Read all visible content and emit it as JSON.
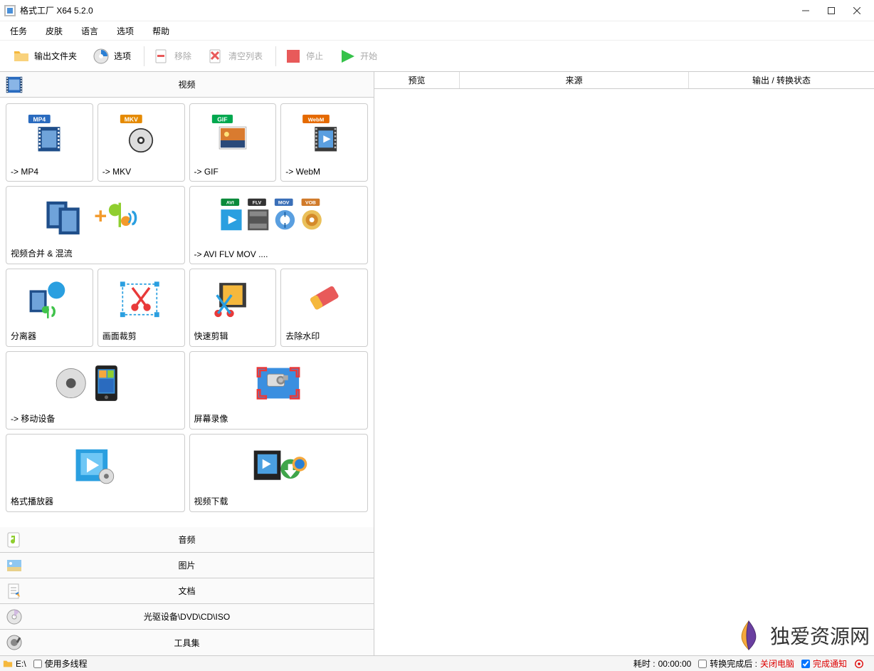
{
  "window": {
    "title": "格式工厂 X64 5.2.0"
  },
  "menus": {
    "task": "任务",
    "skin": "皮肤",
    "language": "语言",
    "options": "选项",
    "help": "帮助"
  },
  "toolbar": {
    "output_folder": "输出文件夹",
    "options": "选项",
    "remove": "移除",
    "clear_list": "清空列表",
    "stop": "停止",
    "start": "开始"
  },
  "categories": {
    "video": "视频",
    "audio": "音频",
    "picture": "图片",
    "document": "文档",
    "disc": "光驱设备\\DVD\\CD\\ISO",
    "tools": "工具集"
  },
  "tiles": {
    "mp4": "-> MP4",
    "mkv": "-> MKV",
    "gif": "-> GIF",
    "webm": "-> WebM",
    "merge_mux": "视频合并 & 混流",
    "more_formats": "-> AVI FLV MOV ....",
    "splitter": "分离器",
    "crop": "画面裁剪",
    "quick_trim": "快速剪辑",
    "remove_wm": "去除水印",
    "mobile": "-> 移动设备",
    "screen_rec": "屏幕录像",
    "player": "格式播放器",
    "download": "视频下载"
  },
  "list_headers": {
    "preview": "预览",
    "source": "来源",
    "output_status": "输出 / 转换状态"
  },
  "statusbar": {
    "drive": "E:\\",
    "multithread": "使用多线程",
    "elapsed_label": "耗时 :",
    "elapsed_value": "00:00:00",
    "after_convert": "转换完成后 :",
    "shutdown": "关闭电脑",
    "notify": "完成通知"
  },
  "watermark": "独爱资源网",
  "badges": {
    "mp4": "MP4",
    "mkv": "MKV",
    "gif": "GIF",
    "webm": "WebM",
    "avi": "AVI",
    "flv": "FLV",
    "mov": "MOV",
    "vob": "VOB"
  },
  "colors": {
    "mp4": "#2a6bbf",
    "mkv": "#e58a00",
    "gif": "#00a84f",
    "webm": "#e56a00",
    "avi": "#0a8a3a",
    "flv": "#333",
    "mov": "#3a6fb8",
    "vob": "#d07a2a",
    "play": "#36c24a",
    "stop": "#e85a5a"
  }
}
